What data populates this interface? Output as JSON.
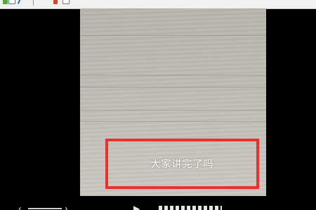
{
  "video": {
    "subtitle": "大家讲完了吗"
  },
  "colors": {
    "highlight_border": "#e8322e",
    "letterbox": "#000000",
    "subtitle_text": "#ffffff"
  },
  "icons": {
    "toolbar": [
      "app-icon",
      "document-icon",
      "edit-icon",
      "bookmark-icon",
      "page-icon"
    ],
    "controls": [
      "previous-icon",
      "next-icon",
      "play-icon"
    ]
  }
}
